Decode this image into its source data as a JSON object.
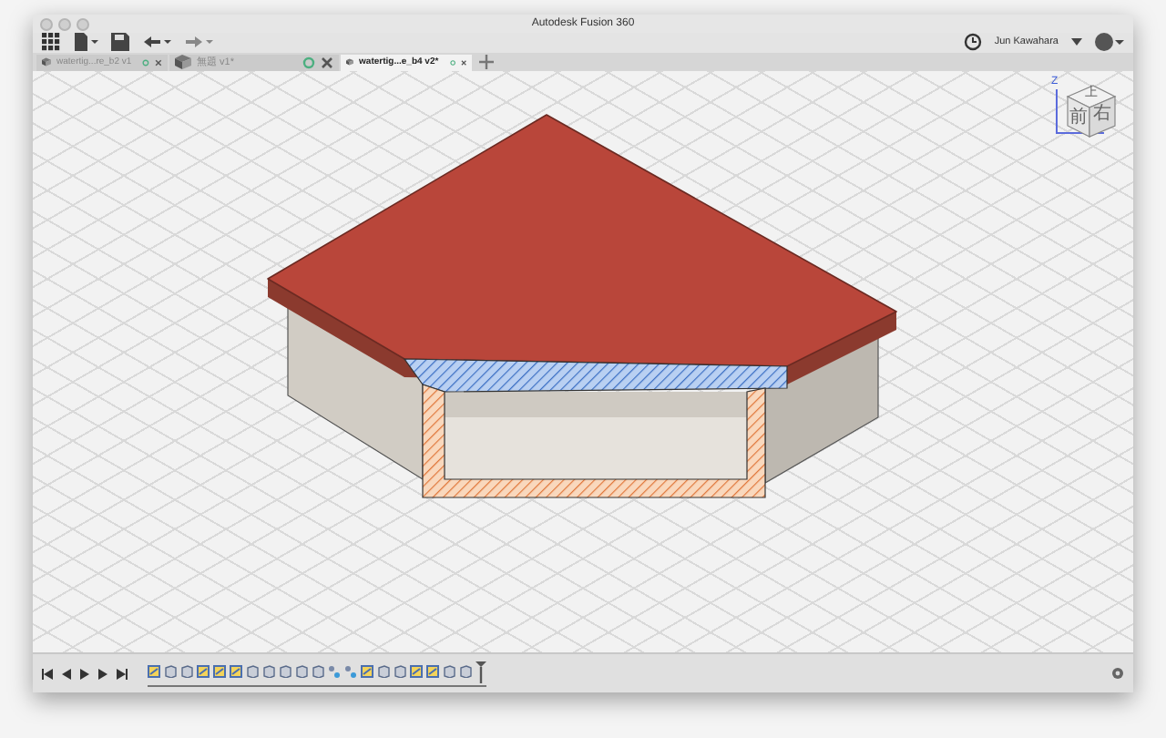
{
  "window": {
    "title": "Autodesk Fusion 360"
  },
  "toolbar": {
    "user": "Jun Kawahara"
  },
  "tabs": [
    {
      "label": "watertig...re_b2 v1",
      "selected": false
    },
    {
      "label": "無題 v1*",
      "selected": false
    },
    {
      "label": "watertig...e_b4 v2*",
      "selected": true
    }
  ],
  "view_cube": {
    "axis": "Z",
    "faces": [
      "上",
      "前",
      "右"
    ]
  },
  "timeline": {
    "features": [
      {
        "kind": "sketch"
      },
      {
        "kind": "body"
      },
      {
        "kind": "body"
      },
      {
        "kind": "sketch"
      },
      {
        "kind": "sketch"
      },
      {
        "kind": "sketch"
      },
      {
        "kind": "body"
      },
      {
        "kind": "body"
      },
      {
        "kind": "body"
      },
      {
        "kind": "body"
      },
      {
        "kind": "body"
      },
      {
        "kind": "joint"
      },
      {
        "kind": "joint"
      },
      {
        "kind": "sketch"
      },
      {
        "kind": "body"
      },
      {
        "kind": "body"
      },
      {
        "kind": "sketch"
      },
      {
        "kind": "sketch"
      },
      {
        "kind": "body"
      },
      {
        "kind": "body"
      }
    ]
  }
}
